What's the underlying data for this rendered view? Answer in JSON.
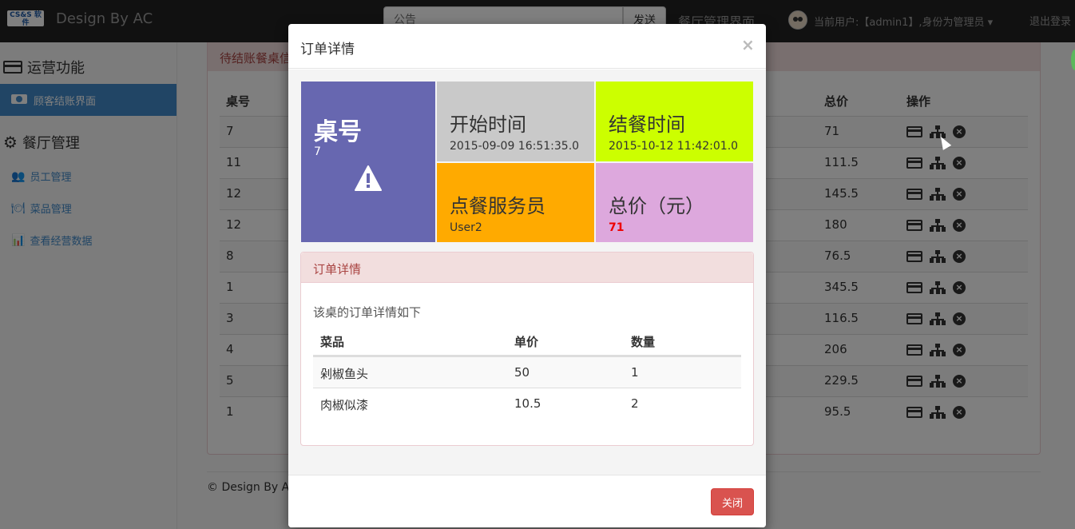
{
  "navbar": {
    "logo_text": "CS&S 软件",
    "brand": "Design By AC",
    "search_placeholder": "公告",
    "search_button": "发送",
    "page_title": "餐厅管理界面",
    "user_label": "当前用户:【admin1】,身份为管理员",
    "user_caret": "▾",
    "logout": "退出登录"
  },
  "sidebar": {
    "section1": "运营功能",
    "active_item": "顾客结账界面",
    "section2": "餐厅管理",
    "items": [
      {
        "label": "员工管理",
        "icon": "users-icon",
        "glyph": "👥"
      },
      {
        "label": "菜品管理",
        "icon": "dish-icon",
        "glyph": "🍽"
      },
      {
        "label": "查看经营数据",
        "icon": "chart-icon",
        "glyph": "📊"
      }
    ]
  },
  "main": {
    "panel_title": "待结账餐桌信息",
    "headers": {
      "table_no": "桌号",
      "total": "总价",
      "actions": "操作"
    },
    "rows": [
      {
        "table": "7",
        "total": "71"
      },
      {
        "table": "11",
        "total": "111.5"
      },
      {
        "table": "12",
        "total": "145.5"
      },
      {
        "table": "12",
        "total": "180"
      },
      {
        "table": "8",
        "total": "76.5"
      },
      {
        "table": "1",
        "total": "345.5"
      },
      {
        "table": "3",
        "total": "116.5"
      },
      {
        "table": "4",
        "total": "206"
      },
      {
        "table": "5",
        "total": "229.5"
      },
      {
        "table": "1",
        "total": "95.5"
      }
    ],
    "footer": "© Design By AC"
  },
  "modal": {
    "title": "订单详情",
    "close_x": "×",
    "tiles": {
      "table_label": "桌号",
      "table_value": "7",
      "start_label": "开始时间",
      "start_value": "2015-09-09 16:51:35.0",
      "end_label": "结餐时间",
      "end_value": "2015-10-12 11:42:01.0",
      "waiter_label": "点餐服务员",
      "waiter_value": "User2",
      "price_label": "总价（元）",
      "price_value": "71"
    },
    "detail": {
      "heading": "订单详情",
      "description": "该桌的订单详情如下",
      "headers": {
        "dish": "菜品",
        "price": "单价",
        "qty": "数量"
      },
      "rows": [
        {
          "dish": "剁椒鱼头",
          "price": "50",
          "qty": "1"
        },
        {
          "dish": "肉椒似漆",
          "price": "10.5",
          "qty": "2"
        }
      ]
    },
    "close_button": "关闭"
  },
  "colors": {
    "navbar": "#222222",
    "accent": "#428bca",
    "tile_table": "#6767b0",
    "tile_start": "#c9c9c9",
    "tile_end": "#ccff00",
    "tile_waiter": "#ffaa00",
    "tile_price": "#dda8dd",
    "danger": "#d9534f"
  }
}
